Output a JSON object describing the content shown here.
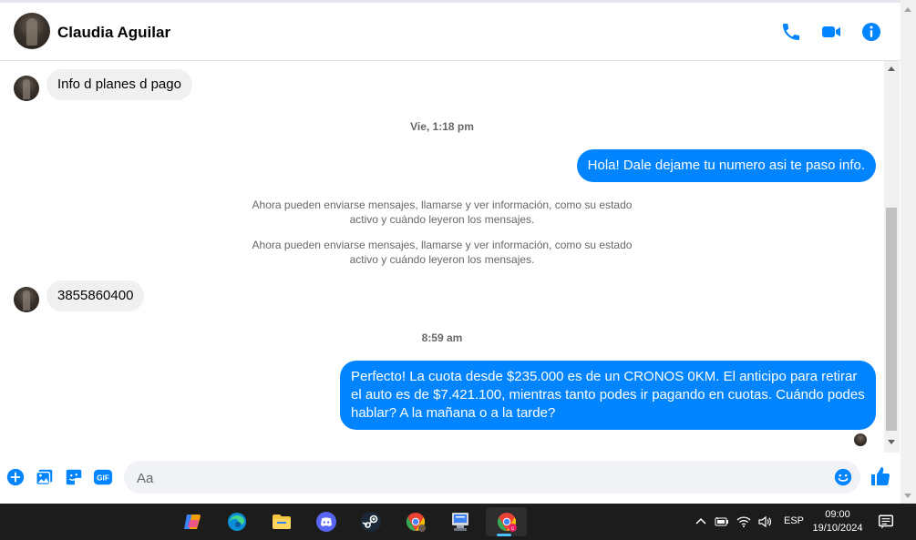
{
  "header": {
    "contact_name": "Claudia Aguilar"
  },
  "messages": [
    {
      "type": "in",
      "text": "Info d planes d pago"
    },
    {
      "type": "timestamp",
      "text": "Vie, 1:18 pm"
    },
    {
      "type": "out",
      "text": "Hola! Dale dejame tu numero  asi te paso info."
    },
    {
      "type": "system",
      "text": "Ahora pueden enviarse mensajes, llamarse y ver información, como su estado activo y cuándo leyeron los mensajes."
    },
    {
      "type": "system",
      "text": "Ahora pueden enviarse mensajes, llamarse y ver información, como su estado activo y cuándo leyeron los mensajes."
    },
    {
      "type": "in",
      "text": "3855860400"
    },
    {
      "type": "timestamp",
      "text": "8:59 am"
    },
    {
      "type": "out",
      "text": "Perfecto! La cuota desde $235.000 es de un CRONOS 0KM. El anticipo para retirar el auto es de $7.421.100, mientras tanto podes ir pagando en cuotas. Cuándo podes hablar? A la mañana o a la tarde?"
    }
  ],
  "composer": {
    "placeholder": "Aa",
    "gif_label": "GIF"
  },
  "taskbar": {
    "language": "ESP",
    "time": "09:00",
    "date": "19/10/2024"
  },
  "colors": {
    "accent": "#0084ff",
    "incoming_bubble": "#f0f0f0",
    "taskbar": "#1c1c1c"
  }
}
